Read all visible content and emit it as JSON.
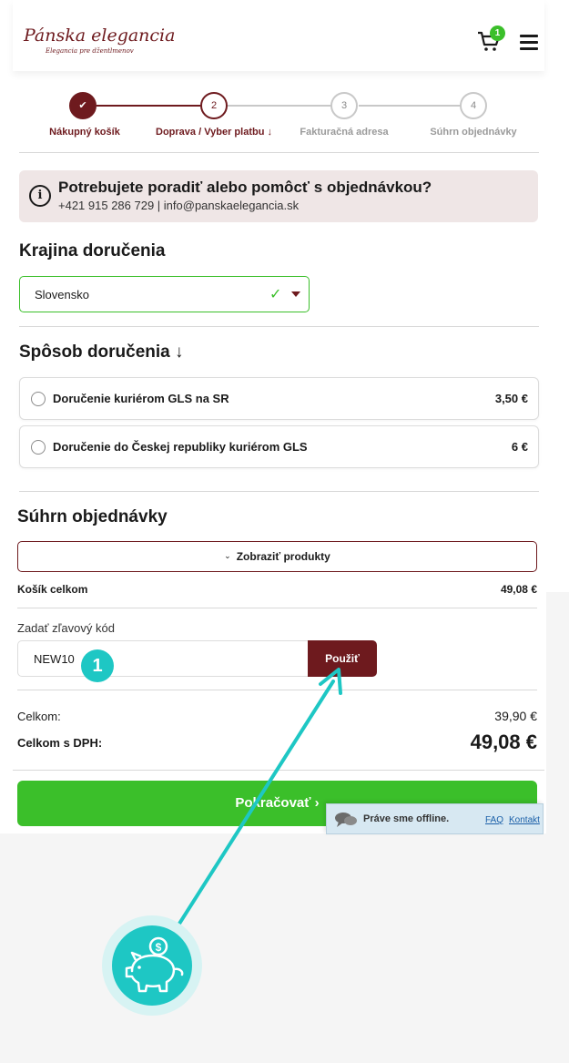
{
  "header": {
    "logo_text": "Pánska elegancia",
    "logo_tagline": "Elegancia pre džentlmenov",
    "cart_badge": "1",
    "icons": [
      "cart-icon",
      "menu-icon"
    ]
  },
  "stepper": {
    "steps": [
      {
        "number": "✔",
        "label": "Nákupný košík",
        "state": "done"
      },
      {
        "number": "2",
        "label": "Doprava / Vyber platbu ↓",
        "state": "active"
      },
      {
        "number": "3",
        "label": "Fakturačná adresa",
        "state": "todo"
      },
      {
        "number": "4",
        "label": "Súhrn objednávky",
        "state": "todo"
      }
    ]
  },
  "help": {
    "title": "Potrebujete poradiť alebo pomôcť s objednávkou?",
    "contact": "+421 915 286 729 | info@panskaelegancia.sk",
    "icon": "i"
  },
  "country": {
    "title": "Krajina doručenia",
    "selected": "Slovensko"
  },
  "shipping": {
    "title": "Spôsob doručenia ↓",
    "options": [
      {
        "label": "Doručenie kuriérom GLS na SR",
        "price": "3,50 €"
      },
      {
        "label": "Doručenie do Českej republiky kuriérom GLS",
        "price": "6 €"
      }
    ]
  },
  "summary": {
    "title": "Súhrn objednávky",
    "show_products": "Zobraziť produkty",
    "cart_total_label": "Košík celkom",
    "cart_total_value": "49,08 €",
    "coupon_label": "Zadať zľavový kód",
    "coupon_value": "NEW10",
    "apply_label": "Použiť",
    "total_label": "Celkom:",
    "total_value": "39,90 €",
    "total_vat_label": "Celkom s DPH:",
    "total_vat_value": "49,08 €",
    "continue_label": "Pokračovať ›"
  },
  "chat": {
    "status": "Práve sme offline.",
    "faq": "FAQ",
    "contact": "Kontakt"
  },
  "annotation": {
    "marker": "1"
  },
  "colors": {
    "brand": "#6e1a1e",
    "green": "#3bbf2a",
    "teal": "#1ec7c4"
  }
}
